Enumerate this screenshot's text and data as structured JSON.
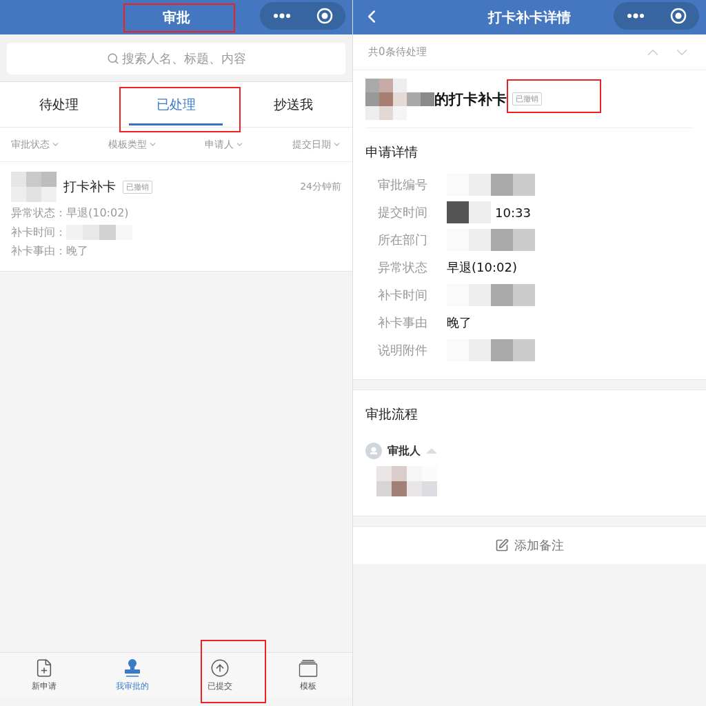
{
  "list_screen": {
    "header": {
      "title": "审批"
    },
    "search": {
      "placeholder": "搜索人名、标题、内容"
    },
    "tabs": [
      {
        "label": "待处理",
        "selected": false
      },
      {
        "label": "已处理",
        "selected": true
      },
      {
        "label": "抄送我",
        "selected": false
      }
    ],
    "filters": [
      "审批状态",
      "模板类型",
      "申请人",
      "提交日期"
    ],
    "items": [
      {
        "title": "打卡补卡",
        "tag": "已撤销",
        "time": "24分钟前",
        "lines": [
          {
            "label": "异常状态：",
            "value": "早退(10:02)",
            "redacted": false
          },
          {
            "label": "补卡时间：",
            "redacted": true
          },
          {
            "label": "补卡事由：",
            "value": "晚了",
            "redacted": false
          }
        ]
      }
    ],
    "bottom_nav": [
      {
        "label": "新申请",
        "kind": "new",
        "selected": false
      },
      {
        "label": "我审批的",
        "kind": "stamp",
        "selected": true
      },
      {
        "label": "已提交",
        "kind": "submitted",
        "selected": false
      },
      {
        "label": "模板",
        "kind": "templates",
        "selected": false
      }
    ]
  },
  "detail_screen": {
    "header": {
      "title": "打卡补卡详情"
    },
    "pending": "共0条待处理",
    "title": "的打卡补卡",
    "tag": "已撤销",
    "details_heading": "申请详情",
    "details": [
      {
        "label": "审批编号",
        "redacted": true
      },
      {
        "label": "提交时间",
        "redacted": true,
        "value": "10:33"
      },
      {
        "label": "所在部门",
        "redacted": true
      },
      {
        "label": "异常状态",
        "redacted": false,
        "value": "早退(10:02)"
      },
      {
        "label": "补卡时间",
        "redacted": true
      },
      {
        "label": "补卡事由",
        "redacted": false,
        "value": "晚了"
      },
      {
        "label": "说明附件",
        "redacted": true
      }
    ],
    "flow_heading": "审批流程",
    "approver": {
      "label": "审批人",
      "expanded": true
    },
    "add_note": "添加备注"
  }
}
